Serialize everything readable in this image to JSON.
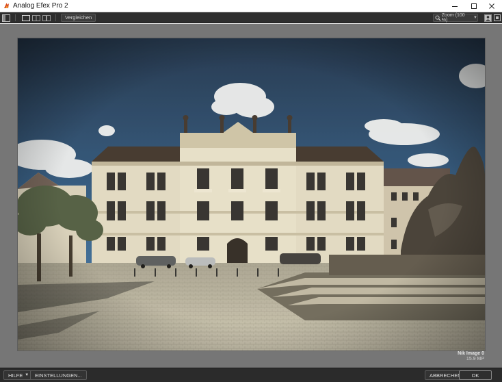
{
  "window": {
    "title": "Analog Efex Pro 2",
    "minimize_label": "—",
    "maximize_label": "☐",
    "close_label": "✕"
  },
  "toolbar": {
    "compare_label": "Vergleichen",
    "zoom_label": "Zoom (100 %)",
    "icons": [
      "sidebar-toggle-icon",
      "single-view-icon",
      "split-view-icon",
      "side-by-side-view-icon",
      "zoom-icon",
      "history-icon",
      "fullscreen-icon"
    ]
  },
  "preview": {
    "image_name": "Nik Image 0",
    "image_size": "15.9 MP"
  },
  "bottombar": {
    "help_label": "HILFE",
    "settings_label": "EINSTELLUNGEN...",
    "cancel_label": "ABBRECHEN",
    "ok_label": "OK"
  },
  "colors": {
    "titlebar_bg": "#ffffff",
    "toolbar_bg": "#2e2e2e",
    "canvas_bg": "#767676",
    "bottombar_bg": "#2b2b2b",
    "sky_dark": "#1d3452",
    "sky_blue": "#3a6a9a",
    "facade": "#e3dcc6",
    "cobblestone": "#bdb7a6"
  }
}
